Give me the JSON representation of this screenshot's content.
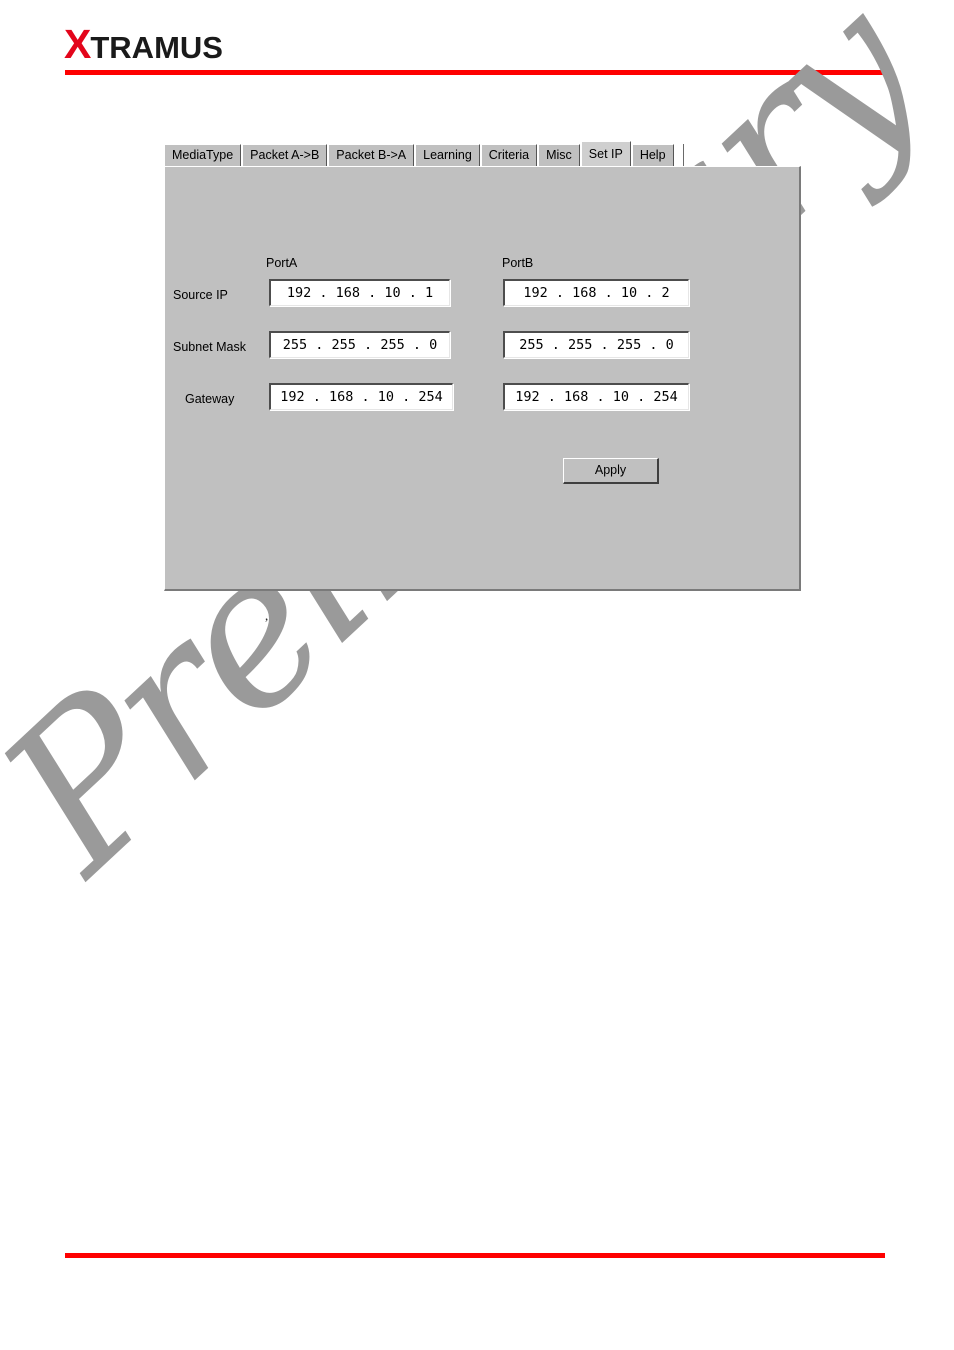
{
  "brand": {
    "logo_x": "X",
    "logo_rest": "TRAMUS",
    "accent_color": "#e3051b",
    "rule_color": "#fe0000"
  },
  "watermark": {
    "text": "Preliminary",
    "color": "#9a9a9a"
  },
  "dialog": {
    "tabs": [
      {
        "label": "MediaType",
        "active": false
      },
      {
        "label": "Packet A->B",
        "active": false
      },
      {
        "label": "Packet B->A",
        "active": false
      },
      {
        "label": "Learning",
        "active": false
      },
      {
        "label": "Criteria",
        "active": false
      },
      {
        "label": "Misc",
        "active": false
      },
      {
        "label": "Set IP",
        "active": true
      },
      {
        "label": "Help",
        "active": false
      }
    ],
    "columns": {
      "port_a": "PortA",
      "port_b": "PortB"
    },
    "rows": [
      {
        "label": "Source IP",
        "port_a": "192 . 168 . 10  .  1",
        "port_b": "192 . 168 . 10  .  2"
      },
      {
        "label": "Subnet Mask",
        "port_a": "255 . 255 . 255 .  0",
        "port_b": "255 . 255 . 255 .  0"
      },
      {
        "label": "Gateway",
        "port_a": "192 . 168 . 10  . 254",
        "port_b": "192 . 168 . 10  . 254"
      }
    ],
    "apply_label": "Apply",
    "panel_color": "#c0c0c0"
  },
  "artifact": {
    "stray_mark": ","
  }
}
